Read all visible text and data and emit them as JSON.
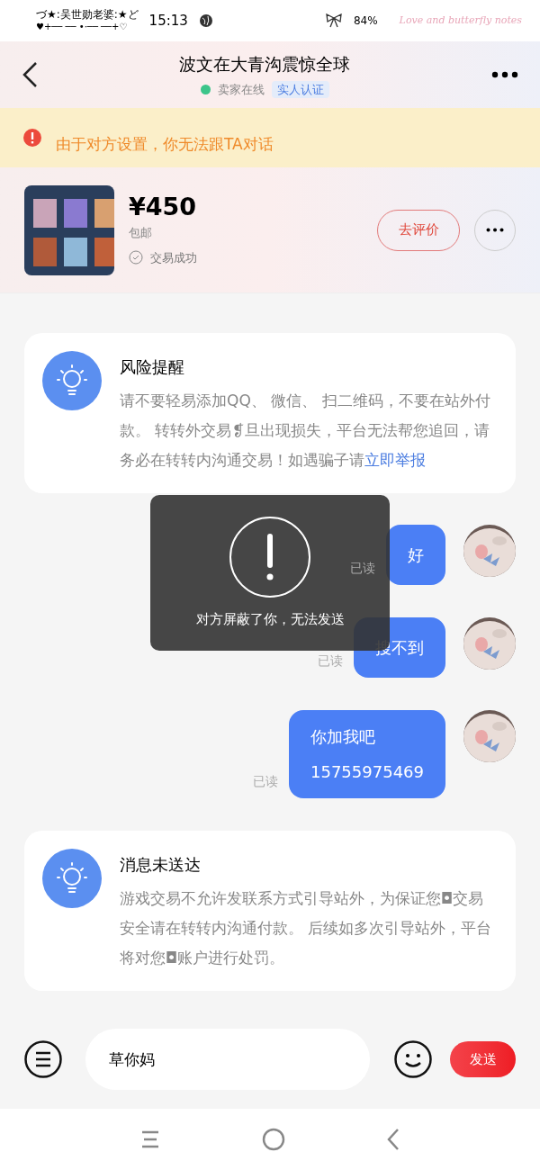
{
  "status_bar": {
    "carrier_line1": "づ★:吴世勋老婆:★ど",
    "carrier_line2": "♥+── ── •·── ──+♡",
    "time": "15:13",
    "battery": "84%",
    "theme_text": "Love and butterfly notes"
  },
  "header": {
    "title": "波文在大青沟震惊全球",
    "seller_status": "卖家在线",
    "online": true,
    "badge": "实人认证"
  },
  "banner": {
    "text": "由于对方设置，你无法跟TA对话"
  },
  "product": {
    "price": "¥450",
    "shipping": "包邮",
    "status": "交易成功",
    "review_button": "去评价"
  },
  "notices": [
    {
      "title": "风险提醒",
      "text": "请不要轻易添加QQ、 微信、 扫二维码，不要在站外付款。 转转外交易❡旦出现损失，平台无法帮您追回，请务必在转转内沟通交易！如遇骗子请",
      "link": "立即举报"
    }
  ],
  "messages": [
    {
      "lines": [
        "好"
      ],
      "read": "已读"
    },
    {
      "lines": [
        "搜不到"
      ],
      "read": "已读"
    },
    {
      "lines": [
        "你加我吧",
        "15755975469"
      ],
      "read": "已读"
    }
  ],
  "notices_after": [
    {
      "title": "消息未送达",
      "text": "游戏交易不允许发联系方式引导站外，为保证您◘交易安全请在转转内沟通付款。 后续如多次引导站外，平台将对您◘账户进行处罚。"
    }
  ],
  "toast": {
    "text": "对方屏蔽了你，无法发送"
  },
  "input": {
    "value": "草你妈",
    "send_button": "发送"
  }
}
